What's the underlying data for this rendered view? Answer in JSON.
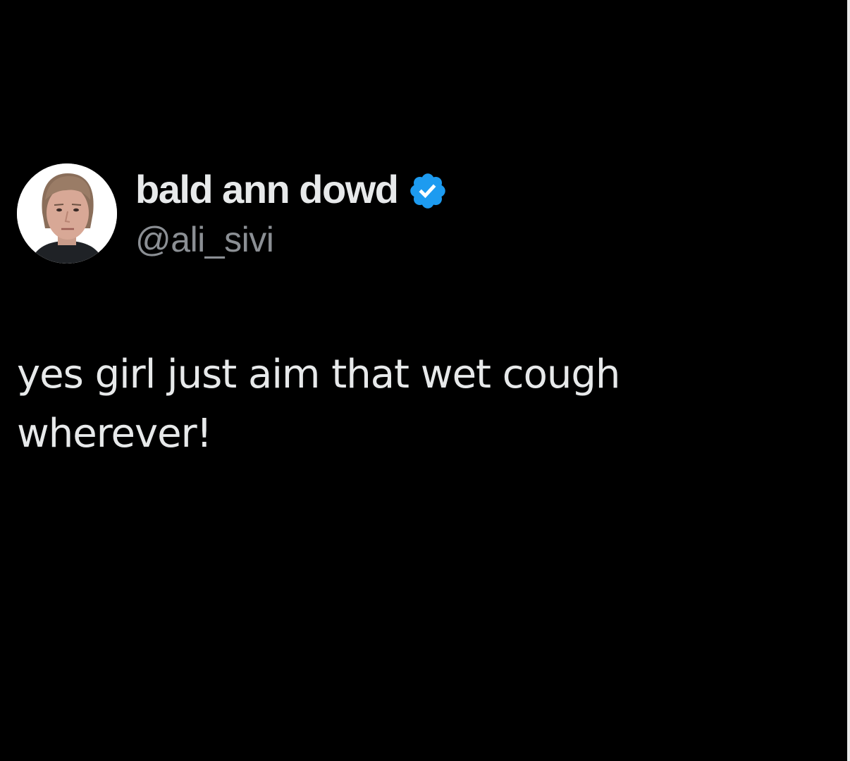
{
  "tweet": {
    "author": {
      "display_name": "bald ann dowd",
      "handle": "@ali_sivi",
      "verified": true,
      "avatar_icon": "profile-photo"
    },
    "text": "yes girl just aim that wet cough wherever!"
  },
  "colors": {
    "background": "#000000",
    "name_text": "#e7e9ea",
    "handle_text": "#8b8f94",
    "verified_badge": "#1d9bf0"
  }
}
